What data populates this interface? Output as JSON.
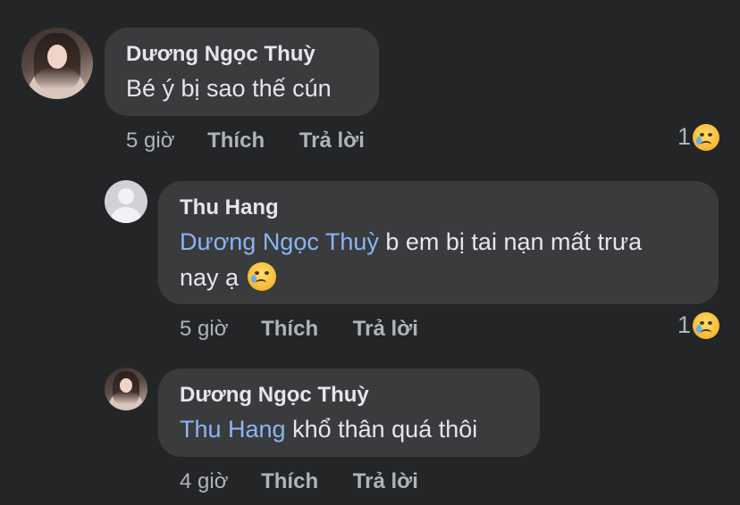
{
  "comments": [
    {
      "author": "Dương Ngọc Thuỳ",
      "text": "Bé ý bị sao thế cún",
      "time": "5 giờ",
      "like": "Thích",
      "reply": "Trả lời",
      "reaction_count": "1",
      "reaction_icon": "sad-face-icon"
    },
    {
      "author": "Thu Hang",
      "mention": "Dương Ngọc Thuỳ",
      "text_line1": " b em bị tai nạn mất trưa",
      "text_line2": "nay ạ",
      "time": "5 giờ",
      "like": "Thích",
      "reply": "Trả lời",
      "reaction_count": "1",
      "reaction_icon": "sad-face-icon"
    },
    {
      "author": "Dương Ngọc Thuỳ",
      "mention": "Thu Hang",
      "text": " khổ thân quá thôi",
      "time": "4 giờ",
      "like": "Thích",
      "reply": "Trả lời"
    }
  ],
  "colors": {
    "background": "#242526",
    "bubble": "#3a3b3c",
    "text": "#e4e6eb",
    "meta": "#b0b3b8",
    "mention": "#8ab4f8"
  }
}
